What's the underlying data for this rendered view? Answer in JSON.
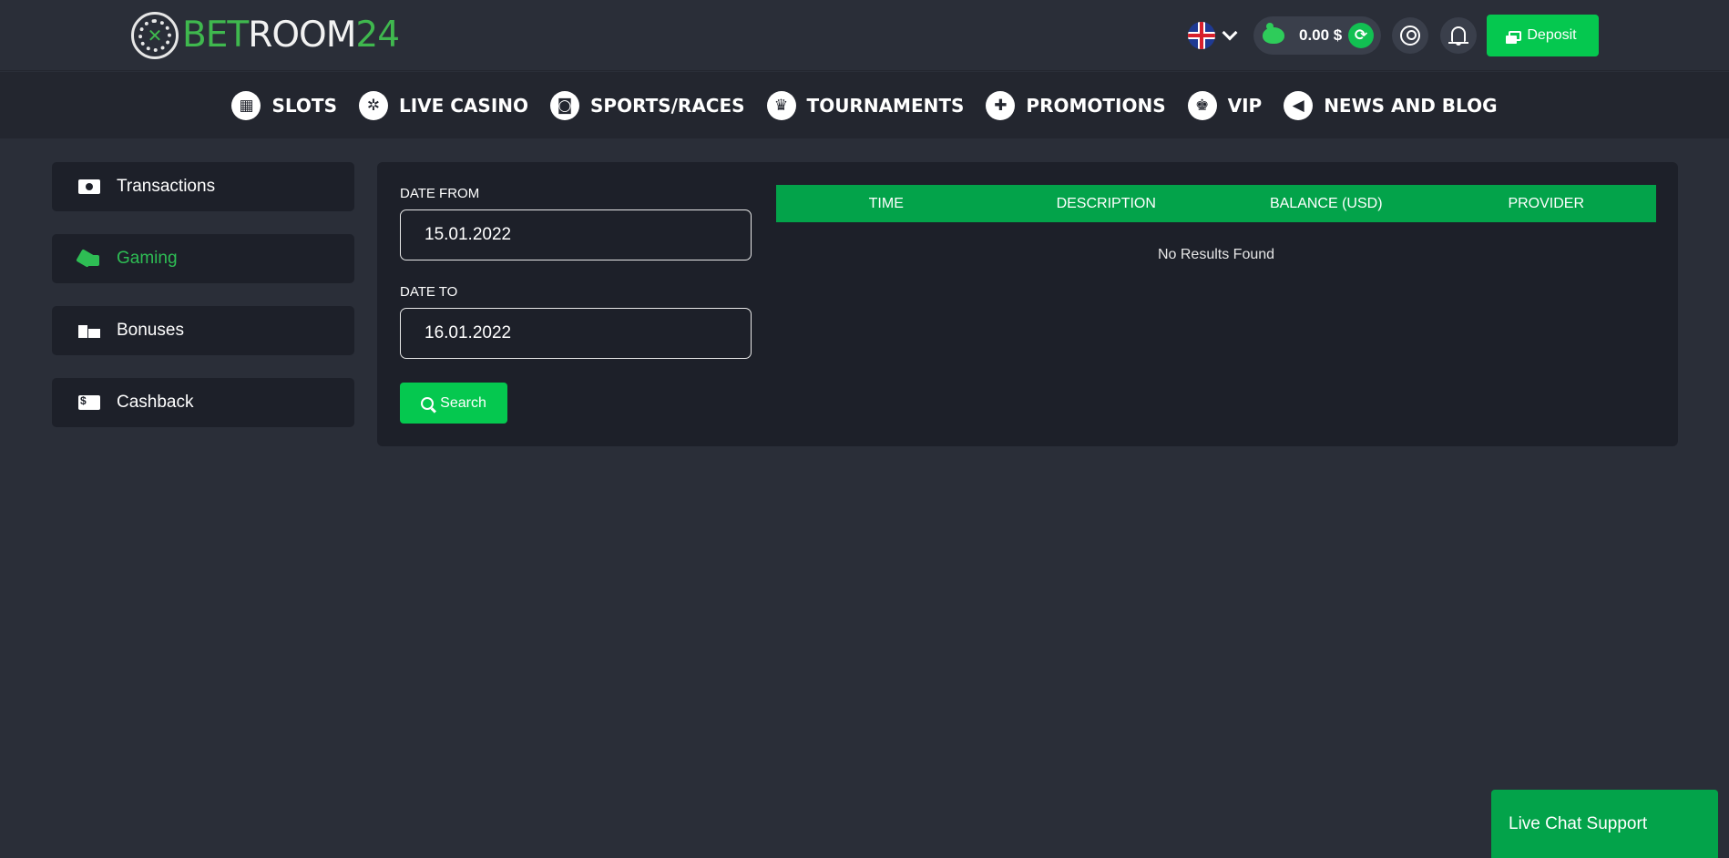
{
  "header": {
    "logo": {
      "bet": "BET",
      "room": "ROOM",
      "num": "24"
    },
    "balance": "0.00 $",
    "deposit_label": "Deposit"
  },
  "nav": [
    {
      "label": "SLOTS",
      "icon": "slot-machine-icon",
      "glyph": "▦"
    },
    {
      "label": "LIVE CASINO",
      "icon": "roulette-icon",
      "glyph": "✲"
    },
    {
      "label": "SPORTS/RACES",
      "icon": "vr-goggles-icon",
      "glyph": "◙"
    },
    {
      "label": "TOURNAMENTS",
      "icon": "podium-icon",
      "glyph": "♛"
    },
    {
      "label": "PROMOTIONS",
      "icon": "gift-icon",
      "glyph": "✚"
    },
    {
      "label": "VIP",
      "icon": "crown-icon",
      "glyph": "♚"
    },
    {
      "label": "NEWS AND BLOG",
      "icon": "megaphone-icon",
      "glyph": "◀"
    }
  ],
  "sidebar": {
    "items": [
      {
        "label": "Transactions",
        "active": false
      },
      {
        "label": "Gaming",
        "active": true
      },
      {
        "label": "Bonuses",
        "active": false
      },
      {
        "label": "Cashback",
        "active": false
      }
    ]
  },
  "filters": {
    "date_from_label": "DATE FROM",
    "date_from_value": "15.01.2022",
    "date_to_label": "DATE TO",
    "date_to_value": "16.01.2022",
    "search_label": "Search"
  },
  "table": {
    "columns": [
      "TIME",
      "DESCRIPTION",
      "BALANCE (USD)",
      "PROVIDER"
    ],
    "empty_message": "No Results Found"
  },
  "chat_label": "Live Chat Support",
  "colors": {
    "accent": "#05c84f",
    "table_header": "#03a34a",
    "active_text": "#2ebd54",
    "background": "#2a2e38",
    "panel": "#1d2029"
  }
}
